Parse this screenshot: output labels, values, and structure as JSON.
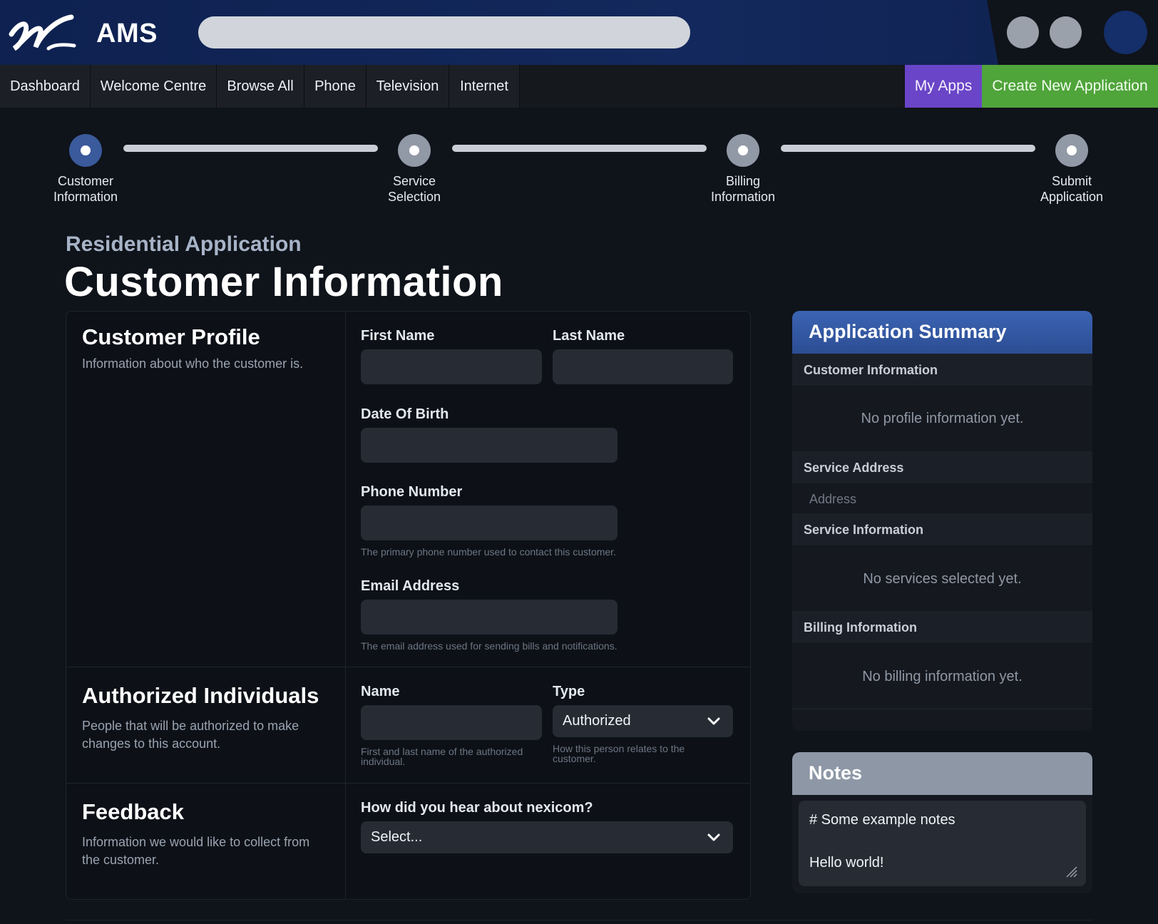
{
  "header": {
    "app_title": "AMS",
    "search": {
      "value": "",
      "placeholder": ""
    }
  },
  "nav": {
    "items": [
      "Dashboard",
      "Welcome Centre",
      "Browse All",
      "Phone",
      "Television",
      "Internet"
    ],
    "my_apps": "My Apps",
    "create_new": "Create New Application"
  },
  "stepper": {
    "steps": [
      {
        "line1": "Customer",
        "line2": "Information",
        "active": true
      },
      {
        "line1": "Service",
        "line2": "Selection",
        "active": false
      },
      {
        "line1": "Billing",
        "line2": "Information",
        "active": false
      },
      {
        "line1": "Submit",
        "line2": "Application",
        "active": false
      }
    ]
  },
  "page": {
    "kicker": "Residential Application",
    "title": "Customer Information"
  },
  "sections": {
    "profile": {
      "title": "Customer Profile",
      "desc": "Information about who the customer is.",
      "first_name_label": "First Name",
      "last_name_label": "Last Name",
      "dob_label": "Date Of Birth",
      "phone_label": "Phone Number",
      "phone_help": "The primary phone number used to contact this customer.",
      "email_label": "Email Address",
      "email_help": "The email address used for sending bills and notifications."
    },
    "authorized": {
      "title": "Authorized Individuals",
      "desc": "People that will be authorized to make changes to this account.",
      "name_label": "Name",
      "name_help": "First and last name of the authorized individual.",
      "type_label": "Type",
      "type_value": "Authorized",
      "type_help": "How this person relates to the customer."
    },
    "feedback": {
      "title": "Feedback",
      "desc": "Information we would like to collect from the customer.",
      "question_label": "How did you hear about nexicom?",
      "question_value": "Select..."
    }
  },
  "summary": {
    "title": "Application Summary",
    "customer_head": "Customer Information",
    "customer_empty": "No profile information yet.",
    "address_head": "Service Address",
    "address_placeholder": "Address",
    "service_head": "Service Information",
    "service_empty": "No services selected yet.",
    "billing_head": "Billing Information",
    "billing_empty": "No billing information yet."
  },
  "notes": {
    "title": "Notes",
    "line1": "# Some example notes",
    "line2": "Hello world!"
  },
  "colors": {
    "brand_navy": "#13285c",
    "my_apps": "#6a45c7",
    "create_new": "#4fa43a",
    "summary_header": "#3b64b3",
    "notes_header": "#8d97a6"
  },
  "icons": [
    "logo-mark",
    "chevron-down-icon",
    "resize-grip-icon"
  ]
}
